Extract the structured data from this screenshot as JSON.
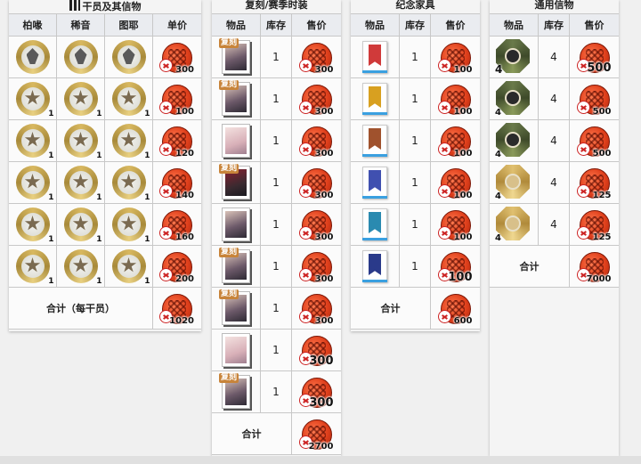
{
  "operators": {
    "title": "干员及其信物",
    "headers": [
      "柏喙",
      "稀音",
      "图耶",
      "单价"
    ],
    "rows": [
      {
        "counts": [
          "",
          "",
          ""
        ],
        "price": "300"
      },
      {
        "counts": [
          "1",
          "1",
          "1"
        ],
        "price": "100"
      },
      {
        "counts": [
          "1",
          "1",
          "1"
        ],
        "price": "120"
      },
      {
        "counts": [
          "1",
          "1",
          "1"
        ],
        "price": "140"
      },
      {
        "counts": [
          "1",
          "1",
          "1"
        ],
        "price": "160"
      },
      {
        "counts": [
          "1",
          "1",
          "1"
        ],
        "price": "200"
      }
    ],
    "total_label": "合计（每干员）",
    "total": "1020"
  },
  "skins": {
    "title": "复刻/赛季时装",
    "headers": [
      "物品",
      "库存",
      "售价"
    ],
    "rows": [
      {
        "tag": "复刻",
        "stock": "1",
        "price": "300",
        "big": false
      },
      {
        "tag": "复刻",
        "stock": "1",
        "price": "300",
        "big": false
      },
      {
        "tag": "",
        "stock": "1",
        "price": "300",
        "big": false
      },
      {
        "tag": "复刻",
        "stock": "1",
        "price": "300",
        "big": false
      },
      {
        "tag": "",
        "stock": "1",
        "price": "300",
        "big": false
      },
      {
        "tag": "复刻",
        "stock": "1",
        "price": "300",
        "big": false
      },
      {
        "tag": "复刻",
        "stock": "1",
        "price": "300",
        "big": false
      },
      {
        "tag": "",
        "stock": "1",
        "price": "300",
        "big": true
      },
      {
        "tag": "复刻",
        "stock": "1",
        "price": "300",
        "big": true
      }
    ],
    "total_label": "合计",
    "total": "2700"
  },
  "furniture": {
    "title": "纪念家具",
    "headers": [
      "物品",
      "库存",
      "售价"
    ],
    "rows": [
      {
        "stock": "1",
        "price": "100",
        "color": "#d03a3a",
        "big": false
      },
      {
        "stock": "1",
        "price": "100",
        "color": "#d8a020",
        "big": false
      },
      {
        "stock": "1",
        "price": "100",
        "color": "#a0522d",
        "big": false
      },
      {
        "stock": "1",
        "price": "100",
        "color": "#4050b0",
        "big": false
      },
      {
        "stock": "1",
        "price": "100",
        "color": "#2a8ab0",
        "big": false
      },
      {
        "stock": "1",
        "price": "100",
        "color": "#2a3a8a",
        "big": true
      }
    ],
    "total_label": "合计",
    "total": "600"
  },
  "general": {
    "title": "通用信物",
    "headers": [
      "物品",
      "库存",
      "售价"
    ],
    "rows": [
      {
        "count": "4",
        "stock": "4",
        "price": "500",
        "big": true,
        "gold": false
      },
      {
        "count": "4",
        "stock": "4",
        "price": "500",
        "big": false,
        "gold": false
      },
      {
        "count": "4",
        "stock": "4",
        "price": "500",
        "big": false,
        "gold": false
      },
      {
        "count": "4",
        "stock": "4",
        "price": "125",
        "big": false,
        "gold": true
      },
      {
        "count": "4",
        "stock": "4",
        "price": "125",
        "big": false,
        "gold": true
      }
    ],
    "total_label": "合计",
    "total": "7000"
  },
  "icons": {
    "currency": "currency-token-icon",
    "operator": "operator-token-icon",
    "skin": "outfit-icon",
    "furniture": "banner-icon",
    "general": "general-token-icon"
  }
}
